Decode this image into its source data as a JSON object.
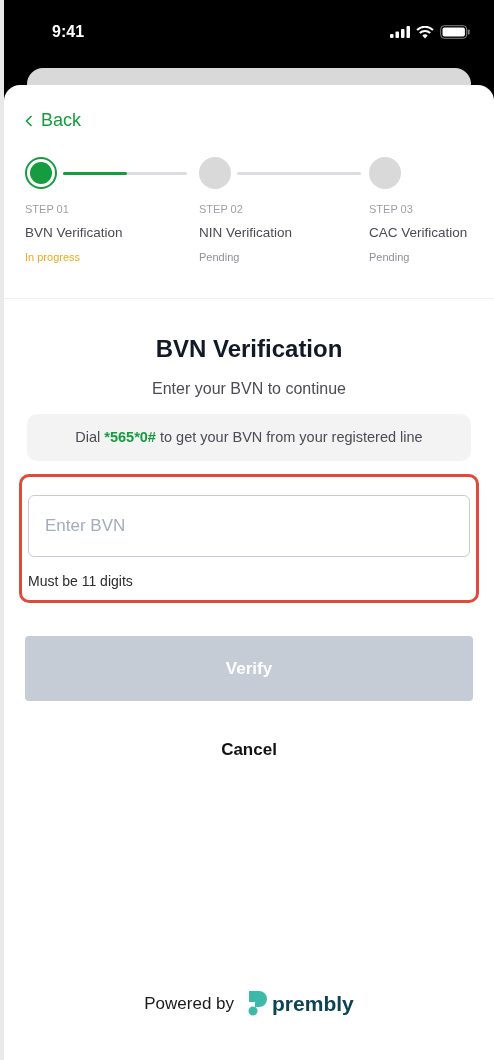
{
  "status_bar": {
    "time": "9:41"
  },
  "back": {
    "label": "Back"
  },
  "steps": [
    {
      "number": "STEP 01",
      "title": "BVN Verification",
      "status": "In progress",
      "selected": true,
      "connector": {
        "level": 0.52
      }
    },
    {
      "number": "STEP 02",
      "title": "NIN Verification",
      "status": "Pending",
      "selected": false,
      "connector": {
        "level": 0
      }
    },
    {
      "number": "STEP 03",
      "title": "CAC Verification",
      "status": "Pending",
      "selected": false
    }
  ],
  "heading": "BVN Verification",
  "subtitle": "Enter your BVN to continue",
  "hint": [
    {
      "text": "Dial ",
      "code": false
    },
    {
      "text": "*565*0#",
      "code": true
    },
    {
      "text": " to get your BVN from your registered line",
      "code": false
    }
  ],
  "field": {
    "placeholder": "Enter BVN",
    "helper": "Must be 11 digits",
    "highlighted": true
  },
  "verify_button": {
    "label": "Verify",
    "disabled": true
  },
  "cancel_button": {
    "label": "Cancel"
  },
  "footer": {
    "powered_by": "Powered by",
    "brand": "prembly"
  }
}
